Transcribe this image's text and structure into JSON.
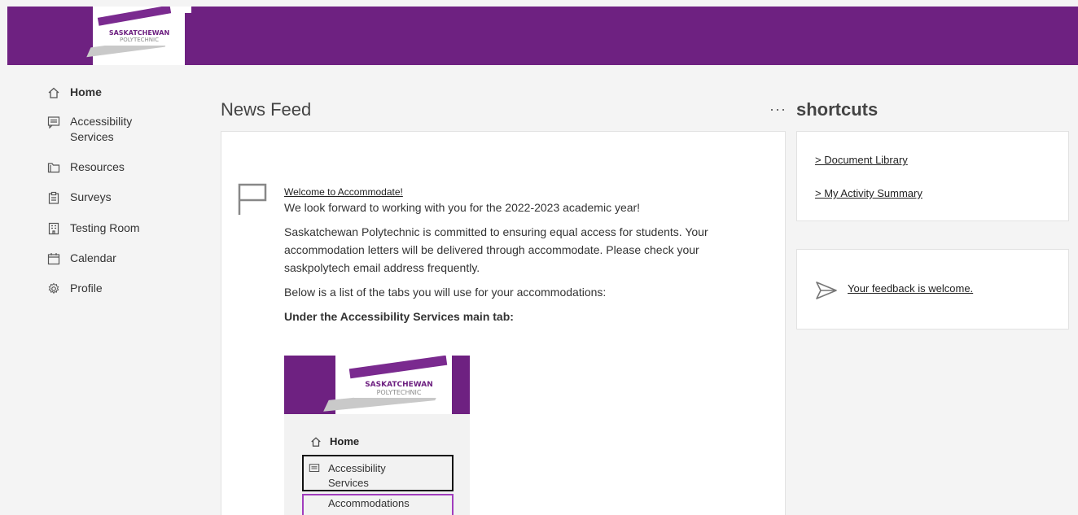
{
  "header": {
    "logo_line1": "SASKATCHEWAN",
    "logo_line2": "POLYTECHNIC",
    "brand_color": "#6e2181"
  },
  "sidebar": {
    "items": [
      {
        "label": "Home",
        "icon": "home-icon",
        "active": true
      },
      {
        "label": "Accessibility Services",
        "icon": "message-icon"
      },
      {
        "label": "Resources",
        "icon": "folder-icon"
      },
      {
        "label": "Surveys",
        "icon": "clipboard-icon"
      },
      {
        "label": "Testing Room",
        "icon": "building-icon"
      },
      {
        "label": "Calendar",
        "icon": "calendar-icon"
      },
      {
        "label": "Profile",
        "icon": "gear-icon"
      }
    ]
  },
  "main": {
    "title": "News Feed",
    "more_label": "···",
    "post": {
      "link": "Welcome to Accommodate!",
      "p1": "We look forward to working with you for the 2022-2023 academic year!",
      "p2": "Saskatchewan Polytechnic is committed to ensuring equal access for students. Your accommodation letters will be delivered through accommodate. Please check your saskpolytech email address frequently.",
      "p3": "Below is a list of the tabs you will use for your accommodations:",
      "heading": "Under the Accessibility Services main tab:",
      "embed": {
        "logo_line1": "SASKATCHEWAN",
        "logo_line2": "POLYTECHNIC",
        "home": "Home",
        "accessibility": "Accessibility Services",
        "next_item": "Accommodations"
      }
    }
  },
  "shortcuts": {
    "title": "shortcuts",
    "links": [
      "> Document Library",
      "> My Activity Summary"
    ],
    "feedback": "Your feedback is welcome."
  }
}
